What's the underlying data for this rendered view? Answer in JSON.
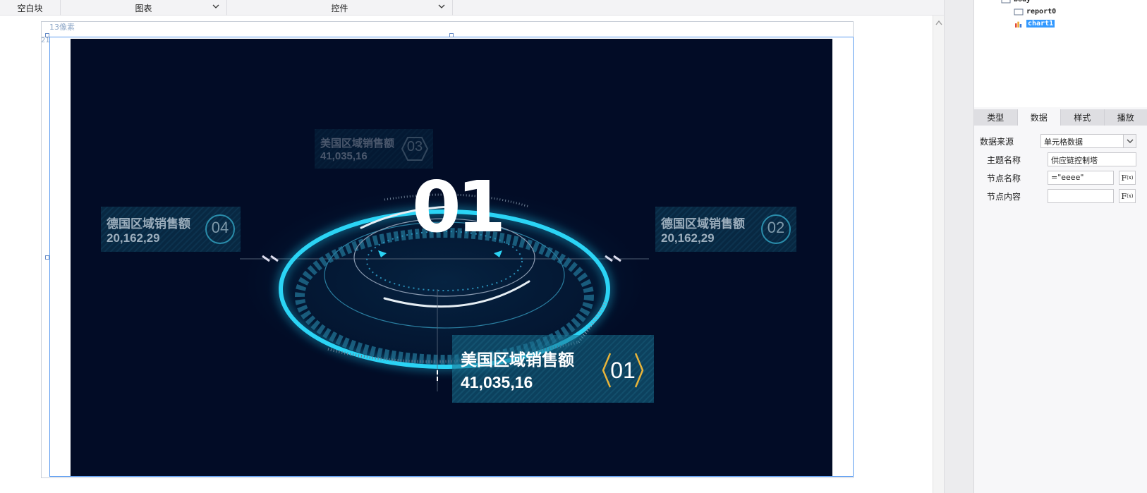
{
  "toolbar": {
    "items": [
      {
        "label": "空白块"
      },
      {
        "label": "图表"
      },
      {
        "label": "控件"
      }
    ]
  },
  "canvas": {
    "ruler_label": "13像素",
    "ruler_left_number": "21"
  },
  "chart": {
    "big_number": "01",
    "cards": [
      {
        "title": "美国区域销售额",
        "value": "41,035,16",
        "badge": "03"
      },
      {
        "title": "德国区域销售额",
        "value": "20,162,29",
        "badge": "04"
      },
      {
        "title": "德国区域销售额",
        "value": "20,162,29",
        "badge": "02"
      },
      {
        "title": "美国区域销售额",
        "value": "41,035,16",
        "badge": "01"
      }
    ],
    "colors": {
      "background": "#020c26",
      "ring": "#1ec8ee",
      "highlight_badge": "#e8b43a"
    }
  },
  "tree": {
    "items": [
      {
        "label": "body"
      },
      {
        "label": "report0"
      },
      {
        "label": "chart1",
        "selected": true
      }
    ]
  },
  "panel": {
    "tabs": [
      {
        "label": "类型"
      },
      {
        "label": "数据",
        "active": true
      },
      {
        "label": "样式"
      },
      {
        "label": "播放"
      }
    ],
    "form": {
      "data_source_label": "数据来源",
      "data_source_value": "单元格数据",
      "theme_name_label": "主题名称",
      "theme_name_value": "供应链控制塔",
      "node_name_label": "节点名称",
      "node_name_value": "=\"eeee\"",
      "node_content_label": "节点内容",
      "node_content_value": "",
      "fx_label": "F"
    }
  }
}
